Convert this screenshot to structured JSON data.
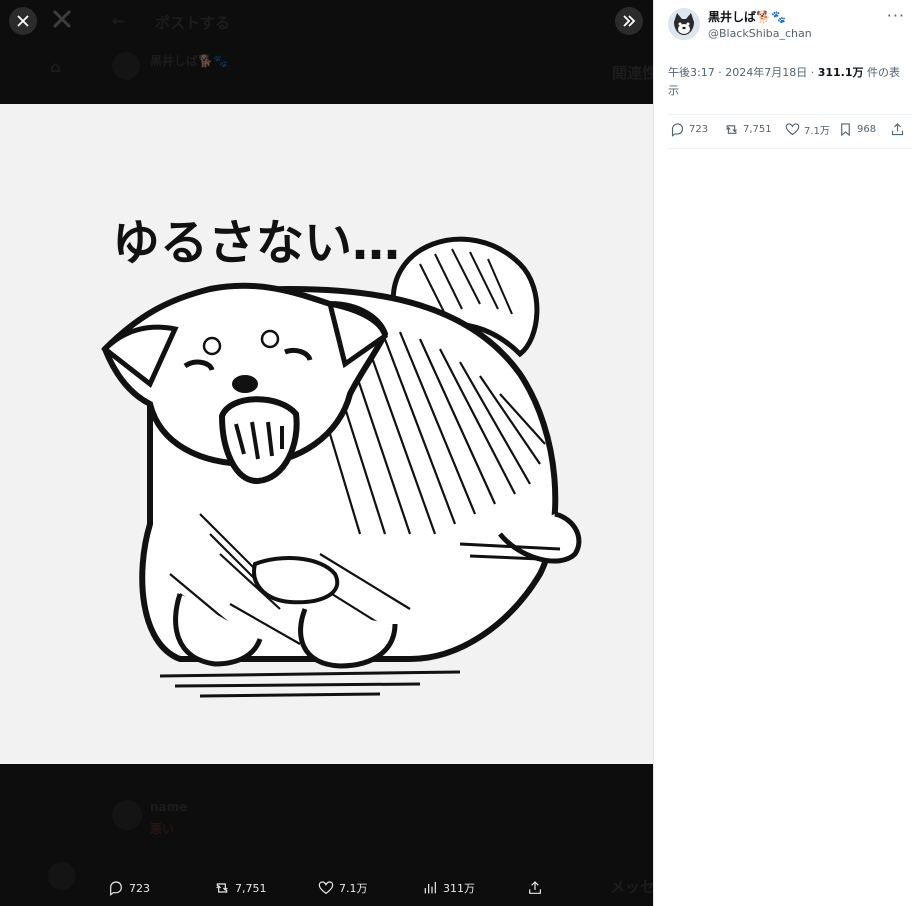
{
  "viewer": {
    "image_alt": "Ink drawing of a shiba dog growling",
    "image_caption_text": "ゆるさない…",
    "close_icon": "close-icon",
    "x_logo": "x-logo-icon",
    "expand_icon": "double-chevron-right-icon"
  },
  "background": {
    "header_title": "ポストする",
    "author_line": "黒井しば🐕🐾",
    "related_label": "関連性",
    "reply_name": "name",
    "reply_text": "悪い",
    "messages_label": "メッセ"
  },
  "bottom_actions": {
    "replies": "723",
    "reposts": "7,751",
    "likes": "7.1万",
    "views": "311万"
  },
  "tweet": {
    "author_name": "黒井しば🐕🐾",
    "author_handle": "@BlackShiba_chan",
    "time": "午後3:17",
    "date": "2024年7月18日",
    "views_count": "311.1万",
    "views_label": "件の表示",
    "more_icon": "more-icon"
  },
  "panel_actions": {
    "replies": "723",
    "reposts": "7,751",
    "likes": "7.1万",
    "bookmarks": "968"
  },
  "colors": {
    "dark_bg": "#0d0d0d",
    "panel_bg": "#ffffff",
    "text_secondary": "#536471",
    "text_primary": "#0f1419"
  }
}
